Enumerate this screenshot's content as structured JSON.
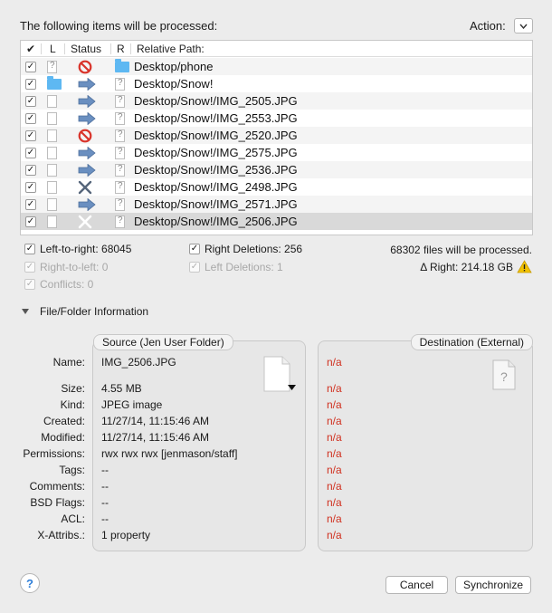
{
  "header": {
    "title": "The following items will be processed:",
    "action_label": "Action:"
  },
  "table": {
    "columns": [
      "✔",
      "L",
      "Status",
      "R",
      "Relative Path:"
    ],
    "rows": [
      {
        "l_icon": "doc-question-icon",
        "status_icon": "no-entry-icon",
        "r_icon": "folder-icon",
        "path": "Desktop/phone"
      },
      {
        "l_icon": "folder-icon",
        "status_icon": "arrow-right-icon",
        "r_icon": "doc-question-icon",
        "path": "Desktop/Snow!"
      },
      {
        "l_icon": "document-icon",
        "status_icon": "arrow-right-icon",
        "r_icon": "doc-question-icon",
        "path": "Desktop/Snow!/IMG_2505.JPG"
      },
      {
        "l_icon": "document-icon",
        "status_icon": "arrow-right-icon",
        "r_icon": "doc-question-icon",
        "path": "Desktop/Snow!/IMG_2553.JPG"
      },
      {
        "l_icon": "document-icon",
        "status_icon": "no-entry-icon",
        "r_icon": "doc-question-icon",
        "path": "Desktop/Snow!/IMG_2520.JPG"
      },
      {
        "l_icon": "document-icon",
        "status_icon": "arrow-right-icon",
        "r_icon": "doc-question-icon",
        "path": "Desktop/Snow!/IMG_2575.JPG"
      },
      {
        "l_icon": "document-icon",
        "status_icon": "arrow-right-icon",
        "r_icon": "doc-question-icon",
        "path": "Desktop/Snow!/IMG_2536.JPG"
      },
      {
        "l_icon": "document-icon",
        "status_icon": "cross-icon",
        "r_icon": "doc-question-icon",
        "path": "Desktop/Snow!/IMG_2498.JPG"
      },
      {
        "l_icon": "document-icon",
        "status_icon": "arrow-right-icon",
        "r_icon": "doc-question-icon",
        "path": "Desktop/Snow!/IMG_2571.JPG"
      },
      {
        "l_icon": "document-icon",
        "status_icon": "cross-white-icon",
        "r_icon": "doc-question-icon",
        "path": "Desktop/Snow!/IMG_2506.JPG"
      }
    ]
  },
  "summary": {
    "left_to_right": "Left-to-right: 68045",
    "right_deletions": "Right Deletions: 256",
    "right_to_left": "Right-to-left: 0",
    "left_deletions": "Left Deletions: 1",
    "conflicts": "Conflicts: 0",
    "files_processed": "68302 files will be processed.",
    "delta_right": "Δ Right: 214.18 GB"
  },
  "info": {
    "section_label": "File/Folder Information",
    "source_tab": "Source (Jen User Folder)",
    "dest_tab": "Destination (External)",
    "labels": [
      "Name:",
      "Size:",
      "Kind:",
      "Created:",
      "Modified:",
      "Permissions:",
      "Tags:",
      "Comments:",
      "BSD Flags:",
      "ACL:",
      "X-Attribs.:"
    ],
    "source_values": [
      "IMG_2506.JPG",
      "4.55 MB",
      "JPEG image",
      "11/27/14, 11:15:46 AM",
      "11/27/14, 11:15:46 AM",
      "rwx rwx rwx   [jenmason/staff]",
      "--",
      "--",
      "--",
      "--",
      "1 property"
    ],
    "dest_values": [
      "n/a",
      "n/a",
      "n/a",
      "n/a",
      "n/a",
      "n/a",
      "n/a",
      "n/a",
      "n/a",
      "n/a",
      "n/a"
    ]
  },
  "footer": {
    "help_label": "?",
    "cancel_label": "Cancel",
    "sync_label": "Synchronize"
  },
  "colors": {
    "na_red": "#d0301f",
    "folder_blue": "#5eb8f2",
    "arrow_blue": "#6a8fc0",
    "no_entry_red": "#d9342b",
    "warning_yellow": "#f2c200"
  }
}
